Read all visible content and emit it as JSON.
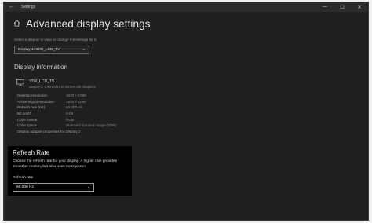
{
  "window": {
    "title": "Settings",
    "back_glyph": "←",
    "minimize_glyph": "—",
    "maximize_glyph": "☐",
    "close_glyph": "✕"
  },
  "page": {
    "title": "Advanced display settings"
  },
  "display_select": {
    "caption": "Select a display to view or change the settings for it.",
    "value": "Display 1: 32W_LCD_TV",
    "chevron": "⌄"
  },
  "display_info": {
    "heading": "Display information",
    "display_name": "32W_LCD_TV",
    "display_sub": "Display 1: Connected to NVIDIA HD Graphics",
    "rows": [
      {
        "label": "Desktop resolution",
        "value": "1920 × 1080"
      },
      {
        "label": "Active signal resolution",
        "value": "1920 × 1080"
      },
      {
        "label": "Refresh rate (Hz)",
        "value": "60.000 Hz"
      },
      {
        "label": "Bit depth",
        "value": "8-bit"
      },
      {
        "label": "Color format",
        "value": "RGB"
      },
      {
        "label": "Color space",
        "value": "Standard dynamic range (SDR)"
      },
      {
        "label": "Display adapter properties for Display 1",
        "value": ""
      }
    ]
  },
  "refresh_panel": {
    "title": "Refresh Rate",
    "description": "Choose the refresh rate for your display. A higher rate provides smoother motion, but also uses more power.",
    "label": "Refresh rate",
    "selected": "60.000 Hz",
    "chevron": "⌄"
  }
}
